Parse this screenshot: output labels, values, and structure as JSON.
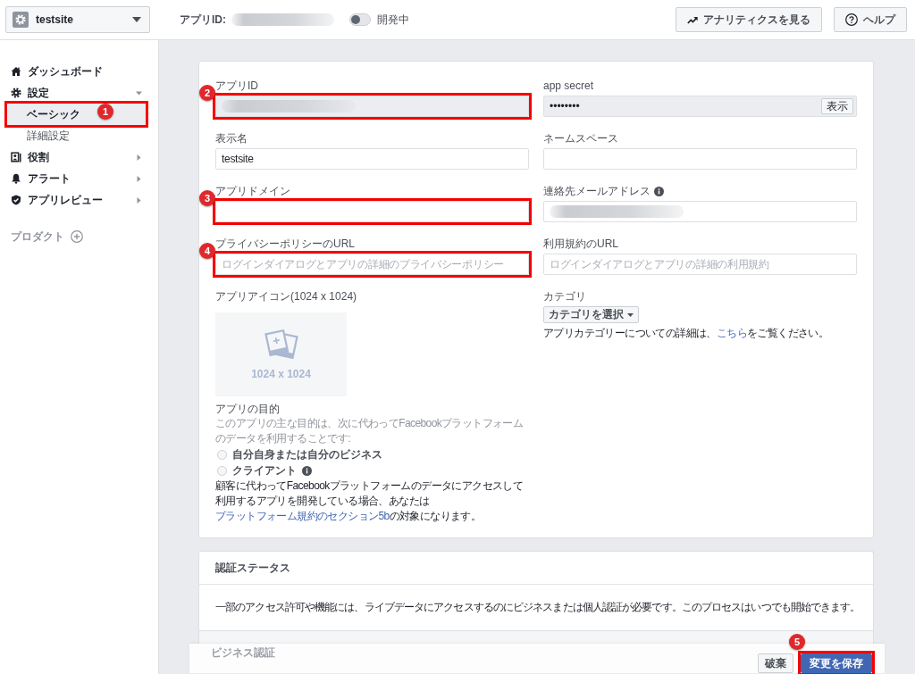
{
  "top_bar": {
    "app_selector": {
      "name": "testsite"
    },
    "app_id": {
      "label": "アプリID:",
      "redacted": true
    },
    "mode_toggle": {
      "label": "開発中",
      "on": false
    },
    "buttons": [
      {
        "kind": "analytics",
        "label": "アナリティクスを見る"
      },
      {
        "kind": "help",
        "label": "ヘルプ"
      }
    ]
  },
  "sidebar": {
    "items": [
      {
        "label": "ダッシュボード",
        "selected": false
      },
      {
        "label": "設定",
        "selected": false,
        "expanded": true,
        "children": [
          {
            "label": "ベーシック",
            "selected": true,
            "annotation": "1"
          },
          {
            "label": "詳細設定",
            "selected": false
          }
        ]
      },
      {
        "label": "役割",
        "selected": false,
        "expanded": false
      },
      {
        "label": "アラート",
        "selected": false,
        "expanded": false
      },
      {
        "label": "アプリレビュー",
        "selected": false,
        "expanded": false
      }
    ],
    "products": {
      "label": "プロダクト"
    }
  },
  "basic_settings": {
    "left_column": [
      {
        "kind": "field",
        "label": "アプリID",
        "disabled": true,
        "redacted": true,
        "annotation": "2"
      },
      {
        "kind": "field",
        "label": "表示名",
        "disabled": false,
        "value": "testsite"
      },
      {
        "kind": "field",
        "label": "アプリドメイン",
        "disabled": false,
        "annotation": "3"
      },
      {
        "kind": "field",
        "label": "プライバシーポリシーのURL",
        "disabled": false,
        "placeholder": "ログインダイアログとアプリの詳細のプライバシーポリシー",
        "annotation": "4"
      },
      {
        "kind": "icon_upload",
        "label": "アプリアイコン(1024 x 1024)",
        "size_text": "1024 x 1024"
      },
      {
        "kind": "radio_group",
        "label": "アプリの目的",
        "description": "このアプリの主な目的は、次に代わってFacebookプラットフォームのデータを利用することです:",
        "options": [
          {
            "label": "自分自身または自分のビジネス",
            "selected": false
          },
          {
            "label": "クライアント",
            "selected": false,
            "info": true
          }
        ],
        "note": {
          "before": "顧客に代わってFacebookプラットフォームのデータにアクセスして利用するアプリを開発している場合、あなたは",
          "link": "プラットフォーム規約のセクション5b",
          "after": "の対象になります。"
        }
      }
    ],
    "right_column": [
      {
        "kind": "field",
        "label": "app secret",
        "disabled": true,
        "value": "••••••••",
        "action": "表示"
      },
      {
        "kind": "field",
        "label": "ネームスペース",
        "disabled": false
      },
      {
        "kind": "field",
        "label": "連絡先メールアドレス",
        "disabled": false,
        "info": true,
        "redacted": true
      },
      {
        "kind": "field",
        "label": "利用規約のURL",
        "disabled": false,
        "placeholder": "ログインダイアログとアプリの詳細の利用規約"
      },
      {
        "kind": "category",
        "label": "カテゴリ",
        "button": "カテゴリを選択",
        "help": {
          "before": "アプリカテゴリーについての詳細は、",
          "link": "こちら",
          "after": "をご覧ください。"
        }
      }
    ]
  },
  "verification_card": {
    "title": "認証ステータス",
    "text": "一部のアクセス許可や機能には、ライブデータにアクセスするのにビジネスまたは個人認証が必要です。このプロセスはいつでも開始できます。",
    "section_title": "ビジネス認証"
  },
  "footer": {
    "buttons": [
      {
        "kind": "discard",
        "label": "破棄"
      },
      {
        "kind": "save",
        "label": "変更を保存",
        "annotation": "5"
      }
    ]
  }
}
